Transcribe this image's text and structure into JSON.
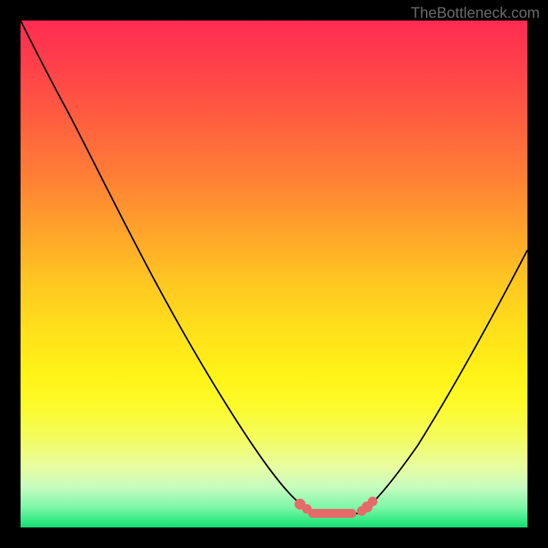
{
  "watermark": "TheBottleneck.com",
  "chart_data": {
    "type": "line",
    "x": [
      0.0,
      0.04,
      0.08,
      0.12,
      0.16,
      0.2,
      0.24,
      0.28,
      0.32,
      0.36,
      0.4,
      0.44,
      0.48,
      0.52,
      0.56,
      0.58,
      0.6,
      0.62,
      0.64,
      0.66,
      0.68,
      0.7,
      0.74,
      0.78,
      0.82,
      0.86,
      0.9,
      0.94,
      0.98,
      1.0
    ],
    "values": [
      1.0,
      0.91,
      0.82,
      0.74,
      0.66,
      0.58,
      0.5,
      0.43,
      0.36,
      0.29,
      0.23,
      0.17,
      0.12,
      0.07,
      0.03,
      0.015,
      0.005,
      0.0,
      0.0,
      0.005,
      0.015,
      0.03,
      0.07,
      0.12,
      0.18,
      0.25,
      0.33,
      0.42,
      0.52,
      0.57
    ],
    "title": "",
    "xlabel": "",
    "ylabel": "",
    "ylim": [
      0,
      1
    ],
    "xlim": [
      0,
      1
    ],
    "annotations": {
      "red_marker_band": {
        "x_start": 0.55,
        "x_end": 0.72,
        "y": 0.02
      }
    }
  },
  "colors": {
    "curve": "#000000",
    "marker": "#e66a6a",
    "background_top": "#ff2b52",
    "background_bottom": "#18da76",
    "frame": "#000000"
  }
}
